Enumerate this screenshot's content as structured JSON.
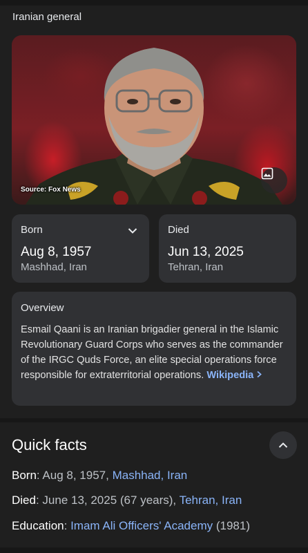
{
  "header": {
    "subtitle": "Iranian general"
  },
  "image": {
    "source": "Source: Fox News",
    "icon": "image-icon"
  },
  "born": {
    "label": "Born",
    "date": "Aug 8, 1957",
    "place": "Mashhad, Iran",
    "icon": "chevron-down-icon"
  },
  "died": {
    "label": "Died",
    "date": "Jun 13, 2025",
    "place": "Tehran, Iran"
  },
  "overview": {
    "label": "Overview",
    "text": "Esmail Qaani is an Iranian brigadier general in the Islamic Revolutionary Guard Corps who serves as the commander of the IRGC Quds Force, an elite special operations force responsible for extraterritorial operations.",
    "link": "Wikipedia",
    "link_icon": "chevron-right-icon"
  },
  "quick_facts": {
    "title": "Quick facts",
    "toggle_icon": "chevron-up-icon",
    "born": {
      "key": "Born",
      "value": ": Aug 8, 1957, ",
      "link": "Mashhad, Iran"
    },
    "died": {
      "key": "Died",
      "value": ": June 13, 2025 (67 years), ",
      "link": "Tehran, Iran"
    },
    "education": {
      "key": "Education",
      "sep": ": ",
      "link": "Imam Ali Officers' Academy",
      "suffix": " (1981)"
    }
  },
  "colors": {
    "background": "#1f1f1f",
    "card": "#303134",
    "link": "#8ab4f8"
  }
}
